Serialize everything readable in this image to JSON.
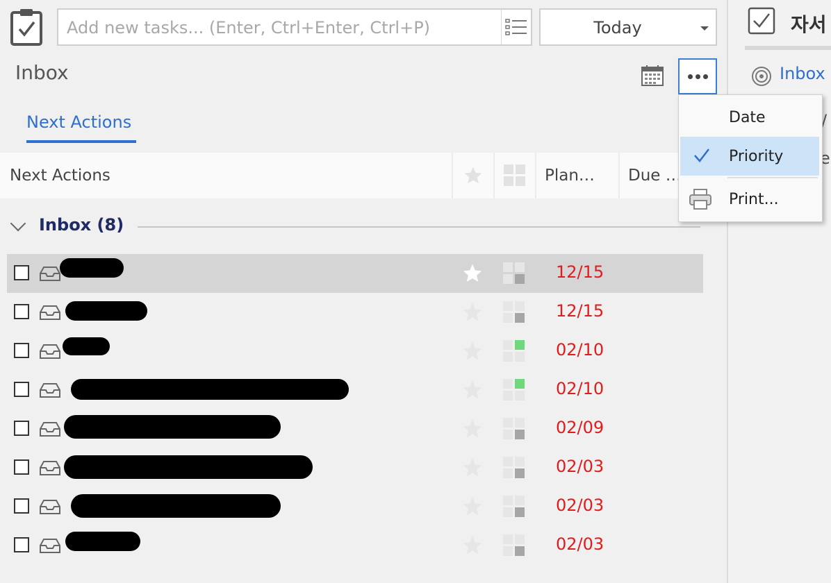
{
  "toolbar": {
    "task_input_placeholder": "Add new tasks... (Enter, Ctrl+Enter, Ctrl+P)",
    "today_select": "Today"
  },
  "page": {
    "title": "Inbox",
    "tab": "Next Actions"
  },
  "table": {
    "headers": [
      "Next Actions",
      "Plan…",
      "Due …"
    ]
  },
  "group": {
    "title": "Inbox (8)"
  },
  "tasks": [
    {
      "date": "12/15",
      "priority": "low",
      "starred": true,
      "selected": true
    },
    {
      "date": "12/15",
      "priority": "low",
      "starred": false
    },
    {
      "date": "02/10",
      "priority": "high",
      "starred": false
    },
    {
      "date": "02/10",
      "priority": "high",
      "starred": false
    },
    {
      "date": "02/09",
      "priority": "low",
      "starred": false
    },
    {
      "date": "02/03",
      "priority": "low",
      "starred": false
    },
    {
      "date": "02/03",
      "priority": "low",
      "starred": false
    },
    {
      "date": "02/03",
      "priority": "low",
      "starred": false
    }
  ],
  "menu": {
    "items": [
      "Date",
      "Priority",
      "Print..."
    ],
    "checked": "Priority"
  },
  "right_pane": {
    "title": "자서",
    "inbox_link": "Inbox",
    "fragment_1": "/",
    "fragment_2": "ec"
  },
  "colors": {
    "accent": "#2f6fcf",
    "date_overdue": "#e01c1c",
    "priority_high": "#6ed87a",
    "priority_low": "#a6a6a6",
    "menu_highlight": "#cde3f7"
  }
}
